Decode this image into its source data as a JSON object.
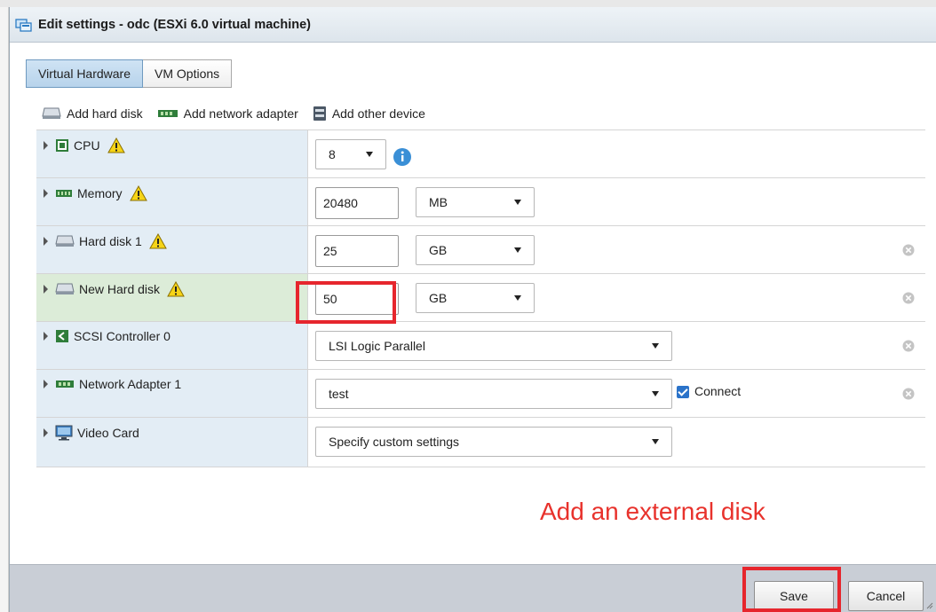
{
  "window": {
    "title": "Edit settings - odc (ESXi 6.0 virtual machine)"
  },
  "tabs": [
    {
      "label": "Virtual Hardware",
      "active": true
    },
    {
      "label": "VM Options",
      "active": false
    }
  ],
  "toolbar": {
    "add_hard_disk": "Add hard disk",
    "add_network_adapter": "Add network adapter",
    "add_other_device": "Add other device"
  },
  "devices": {
    "cpu": {
      "label": "CPU",
      "value": "8",
      "warning": true,
      "icon": "cpu-icon"
    },
    "memory": {
      "label": "Memory",
      "value": "20480",
      "unit": "MB",
      "warning": true,
      "icon": "memory-icon"
    },
    "hard_disk_1": {
      "label": "Hard disk 1",
      "value": "25",
      "unit": "GB",
      "warning": true,
      "icon": "hard-disk-icon"
    },
    "new_hard_disk": {
      "label": "New Hard disk",
      "value": "50",
      "unit": "GB",
      "warning": true,
      "icon": "hard-disk-icon"
    },
    "scsi_controller": {
      "label": "SCSI Controller 0",
      "value": "LSI Logic Parallel",
      "icon": "scsi-controller-icon"
    },
    "network_adapter": {
      "label": "Network Adapter 1",
      "value": "test",
      "connect_label": "Connect",
      "connected": true,
      "icon": "network-adapter-icon"
    },
    "video_card": {
      "label": "Video Card",
      "value": "Specify custom settings",
      "icon": "video-card-icon"
    }
  },
  "annotation": "Add an external disk",
  "footer": {
    "save_label": "Save",
    "cancel_label": "Cancel"
  },
  "colors": {
    "annotation_red": "#e6262d",
    "tab_active": "#b7d3eb",
    "label_cell": "#e3edf5",
    "highlight_cell": "#dcecd8",
    "footer_bg": "#c9ced6"
  }
}
